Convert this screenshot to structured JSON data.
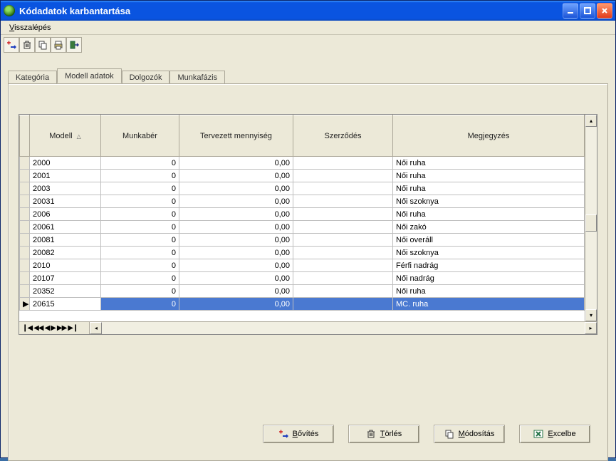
{
  "window": {
    "title": "Kódadatok karbantartása"
  },
  "menubar": {
    "back": "Visszalépés"
  },
  "tabs": {
    "items": [
      {
        "label": "Kategória",
        "active": false
      },
      {
        "label": "Modell adatok",
        "active": true
      },
      {
        "label": "Dolgozók",
        "active": false
      },
      {
        "label": "Munkafázis",
        "active": false
      }
    ]
  },
  "grid": {
    "columns": {
      "model": "Modell",
      "wage": "Munkabér",
      "qty": "Tervezett mennyiség",
      "contract": "Szerződés",
      "note": "Megjegyzés"
    },
    "sort_indicator": "△",
    "rows": [
      {
        "model": "2000",
        "wage": "0",
        "qty": "0,00",
        "contract": "",
        "note": "Női ruha",
        "selected": false
      },
      {
        "model": "2001",
        "wage": "0",
        "qty": "0,00",
        "contract": "",
        "note": "Női ruha",
        "selected": false
      },
      {
        "model": "2003",
        "wage": "0",
        "qty": "0,00",
        "contract": "",
        "note": "Női ruha",
        "selected": false
      },
      {
        "model": "20031",
        "wage": "0",
        "qty": "0,00",
        "contract": "",
        "note": "Női szoknya",
        "selected": false
      },
      {
        "model": "2006",
        "wage": "0",
        "qty": "0,00",
        "contract": "",
        "note": "Női ruha",
        "selected": false
      },
      {
        "model": "20061",
        "wage": "0",
        "qty": "0,00",
        "contract": "",
        "note": "Női zakó",
        "selected": false
      },
      {
        "model": "20081",
        "wage": "0",
        "qty": "0,00",
        "contract": "",
        "note": "Női overáll",
        "selected": false
      },
      {
        "model": "20082",
        "wage": "0",
        "qty": "0,00",
        "contract": "",
        "note": "Női szoknya",
        "selected": false
      },
      {
        "model": "2010",
        "wage": "0",
        "qty": "0,00",
        "contract": "",
        "note": "Férfi nadrág",
        "selected": false
      },
      {
        "model": "20107",
        "wage": "0",
        "qty": "0,00",
        "contract": "",
        "note": "Női nadrág",
        "selected": false
      },
      {
        "model": "20352",
        "wage": "0",
        "qty": "0,00",
        "contract": "",
        "note": "Női ruha",
        "selected": false
      },
      {
        "model": "20615",
        "wage": "0",
        "qty": "0,00",
        "contract": "",
        "note": "MC. ruha",
        "selected": true,
        "marker": "▶"
      }
    ]
  },
  "buttons": {
    "add": "Bővítés",
    "delete": "Törlés",
    "modify": "Módosítás",
    "excel": "Excelbe"
  },
  "toolbar_icons": [
    "add-record-icon",
    "delete-record-icon",
    "copy-record-icon",
    "print-icon",
    "exit-icon"
  ]
}
